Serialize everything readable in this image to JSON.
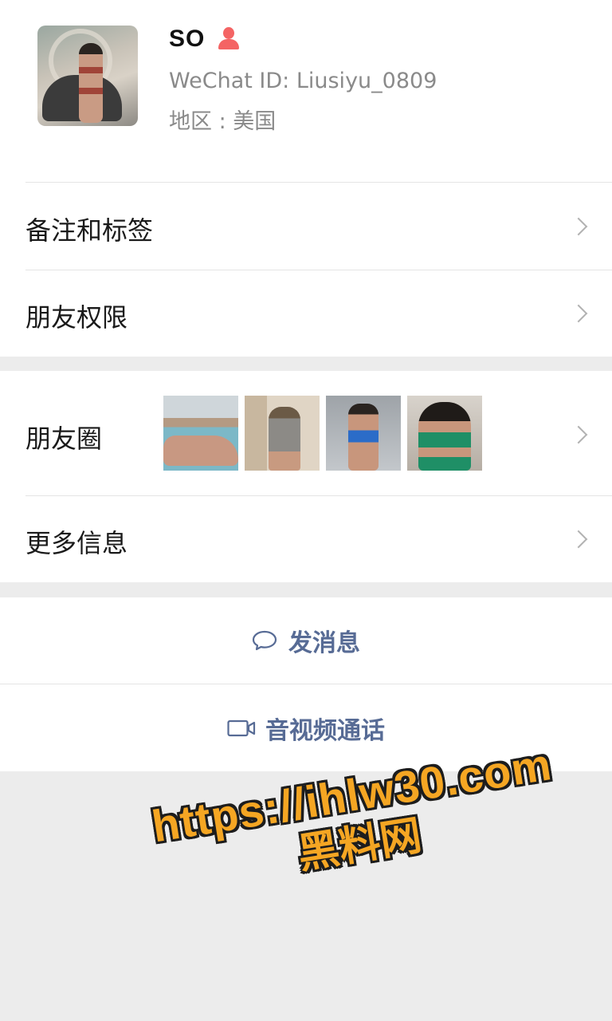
{
  "profile": {
    "name": "SO",
    "gender_icon": "female-user-icon",
    "gender_color": "#f46464",
    "wechat_id": "WeChat ID: Liusiyu_0809",
    "region": "地区 : 美国"
  },
  "menu": {
    "remarks_tags": "备注和标签",
    "friend_permissions": "朋友权限",
    "moments": "朋友圈",
    "more_info": "更多信息"
  },
  "actions": {
    "send_message": "发消息",
    "av_call": "音视频通话",
    "link_color": "#576b95"
  },
  "watermark": {
    "url": "https://ihlw30.com",
    "name": "黑料网"
  }
}
